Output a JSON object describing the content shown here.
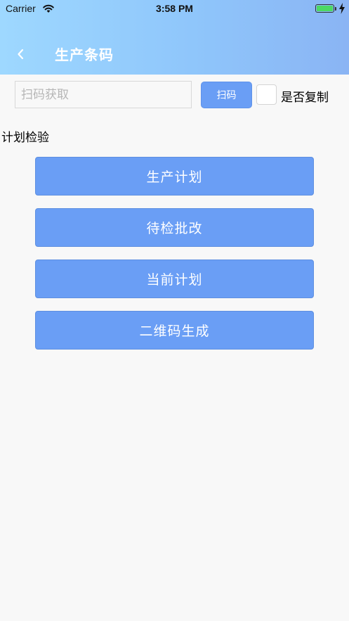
{
  "status_bar": {
    "carrier": "Carrier",
    "time": "3:58 PM",
    "battery_level": 1.0
  },
  "header": {
    "title": "生产条码",
    "back_icon": "chevron-left-icon"
  },
  "scan": {
    "placeholder": "扫码获取",
    "value": "",
    "button_label": "扫码",
    "copy_checkbox_checked": false,
    "copy_label": "是否复制"
  },
  "section": {
    "title": "计划检验"
  },
  "menu": {
    "items": [
      {
        "label": "生产计划"
      },
      {
        "label": "待检批改"
      },
      {
        "label": "当前计划"
      },
      {
        "label": "二维码生成"
      }
    ]
  },
  "colors": {
    "accent": "#6a9ef5",
    "header_gradient_start": "#9ed8ff",
    "header_gradient_end": "#8ab4f4",
    "battery": "#4cd964"
  }
}
